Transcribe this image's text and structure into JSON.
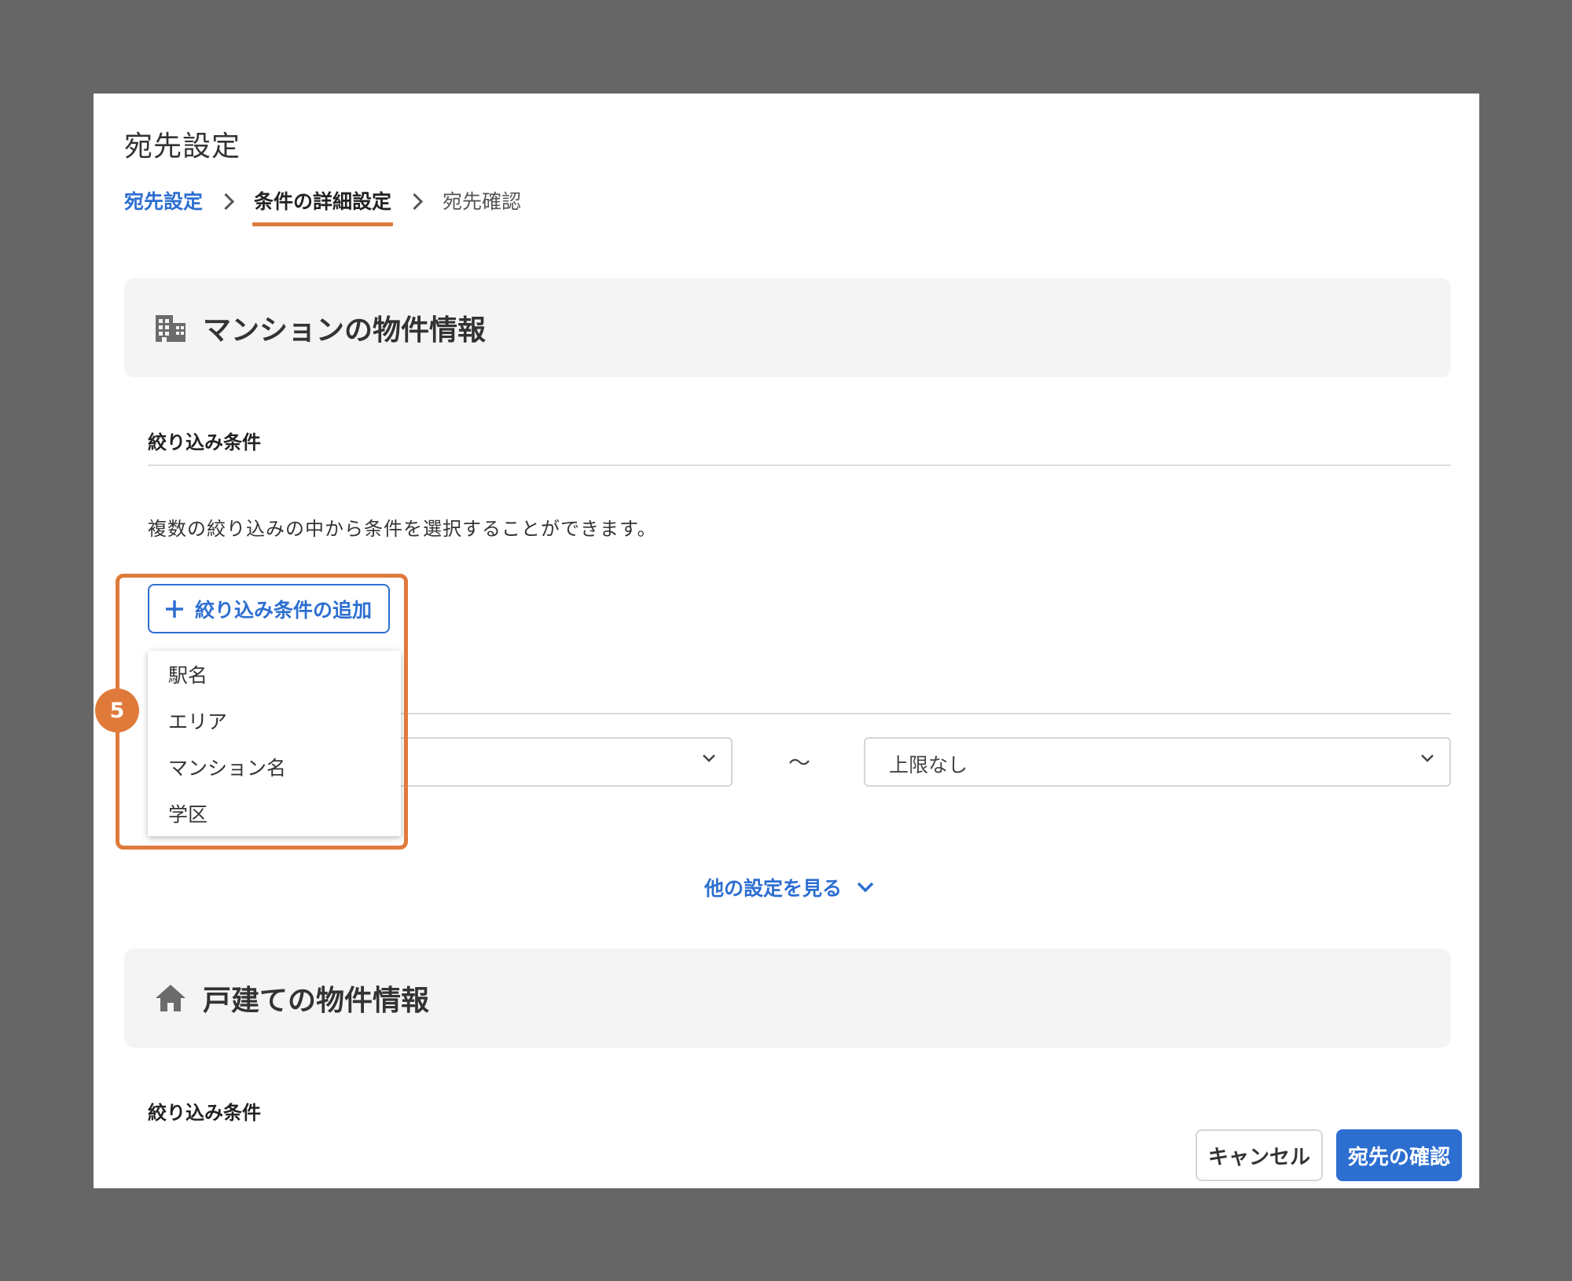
{
  "modal": {
    "title": "宛先設定"
  },
  "breadcrumb": {
    "step1": "宛先設定",
    "step2": "条件の詳細設定",
    "step3": "宛先確認"
  },
  "mansion_section": {
    "icon": "building-icon",
    "title": "マンションの物件情報",
    "filter_heading": "絞り込み条件",
    "description": "複数の絞り込みの中から条件を選択することができます。",
    "add_button_label": "絞り込み条件の追加",
    "dropdown_options": [
      "駅名",
      "エリア",
      "マンション名",
      "学区"
    ],
    "range_separator": "〜",
    "range_max_value": "上限なし",
    "more_settings_label": "他の設定を見る"
  },
  "house_section": {
    "icon": "house-icon",
    "title": "戸建ての物件情報",
    "filter_heading": "絞り込み条件"
  },
  "annotation": {
    "step_number": "5"
  },
  "footer": {
    "cancel_label": "キャンセル",
    "confirm_label": "宛先の確認"
  },
  "colors": {
    "accent": "#2d6fd1",
    "highlight": "#e07a3b",
    "backdrop": "#666666"
  }
}
